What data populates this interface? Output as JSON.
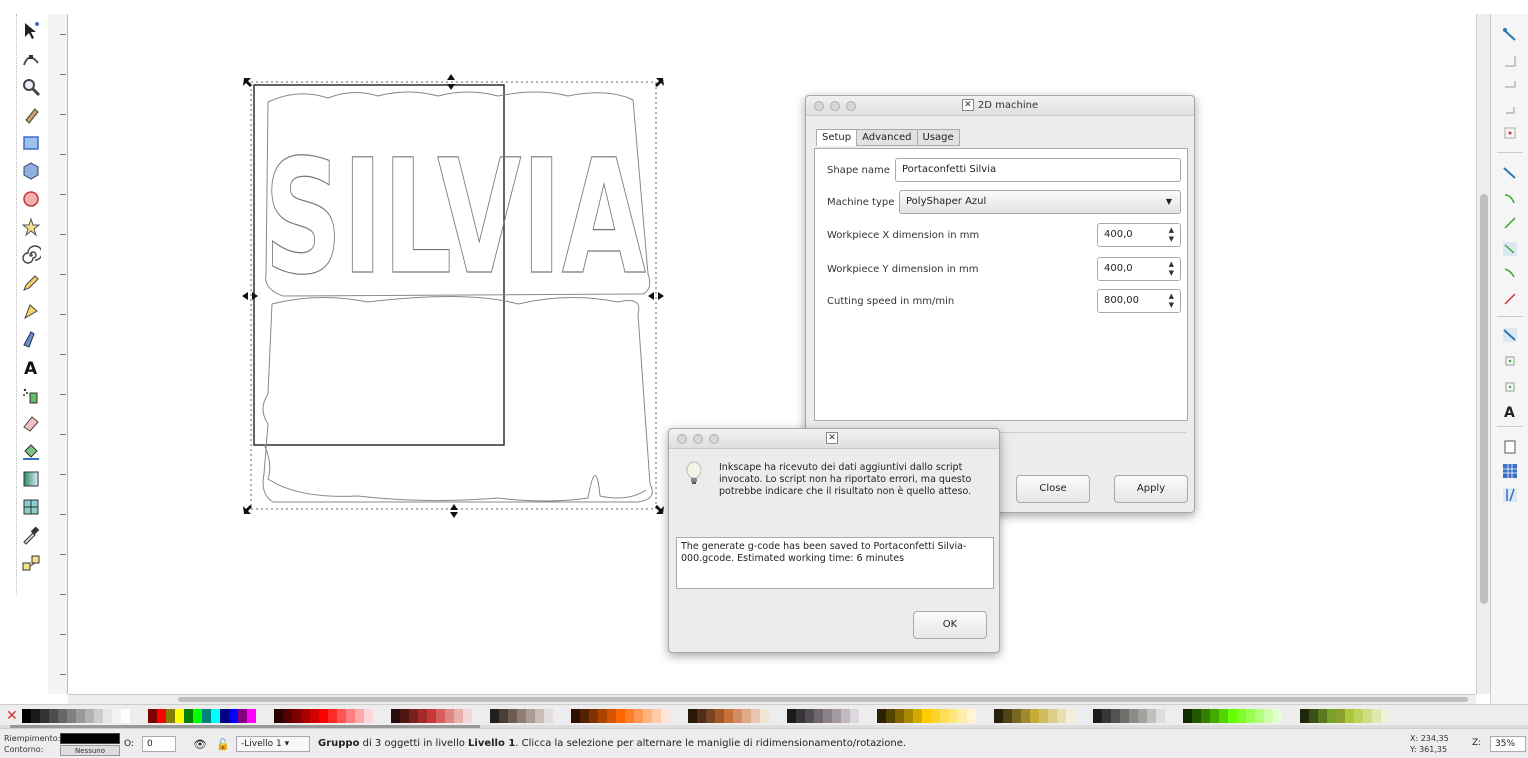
{
  "colors": {
    "accent_blue": "#3a6fc4",
    "canvas_bg": "#ffffff",
    "chrome_bg": "#ececec"
  },
  "toolbox": {
    "tools": [
      {
        "name": "selector-tool-icon"
      },
      {
        "name": "node-tool-icon"
      },
      {
        "name": "zoom-tool-icon"
      },
      {
        "name": "tweak-tool-icon"
      },
      {
        "name": "rectangle-tool-icon"
      },
      {
        "name": "3dbox-tool-icon"
      },
      {
        "name": "ellipse-tool-icon"
      },
      {
        "name": "star-tool-icon"
      },
      {
        "name": "spiral-tool-icon"
      },
      {
        "name": "pencil-tool-icon"
      },
      {
        "name": "pen-tool-icon"
      },
      {
        "name": "calligraphy-tool-icon"
      },
      {
        "name": "text-tool-icon"
      },
      {
        "name": "spray-tool-icon"
      },
      {
        "name": "eraser-tool-icon"
      },
      {
        "name": "paint-bucket-tool-icon"
      },
      {
        "name": "gradient-tool-icon"
      },
      {
        "name": "mesh-tool-icon"
      },
      {
        "name": "dropper-tool-icon"
      },
      {
        "name": "connector-tool-icon"
      }
    ]
  },
  "canvas": {
    "artwork_text": "SILVIA"
  },
  "machine_dialog": {
    "title": "2D machine",
    "tabs": [
      "Setup",
      "Advanced",
      "Usage"
    ],
    "active_tab": "Setup",
    "fields": {
      "shape_name_label": "Shape name",
      "shape_name_value": "Portaconfetti Silvia",
      "machine_type_label": "Machine type",
      "machine_type_value": "PolyShaper Azul",
      "workpiece_x_label": "Workpiece X dimension in mm",
      "workpiece_x_value": "400,0",
      "workpiece_y_label": "Workpiece Y dimension in mm",
      "workpiece_y_value": "400,0",
      "cutting_speed_label": "Cutting speed in mm/min",
      "cutting_speed_value": "800,00"
    },
    "close_label": "Close",
    "apply_label": "Apply"
  },
  "message_dialog": {
    "info_text": "Inkscape ha ricevuto dei dati aggiuntivi dallo script invocato. Lo script non ha riportato errori, ma questo potrebbe indicare che il risultato non è quello atteso.",
    "output_text": "The generate g-code has been saved to Portaconfetti Silvia-000.gcode. Estimated working time: 6 minutes",
    "ok_label": "OK"
  },
  "statusbar": {
    "fill_label": "Riempimento:",
    "stroke_label": "Contorno:",
    "stroke_value": "Nessuno",
    "opacity_label": "O:",
    "opacity_value": "0",
    "layer_value": "-Livello 1",
    "message_bold": "Gruppo",
    "message_part1": " di 3 oggetti in livello ",
    "message_layer": "Livello 1",
    "message_part2": ". Clicca la selezione per alternare le maniglie di ridimensionamento/rotazione.",
    "x_coord": "X: 234,35",
    "y_coord": "Y: 361,35",
    "z_label": "Z:",
    "zoom_value": "35%"
  }
}
